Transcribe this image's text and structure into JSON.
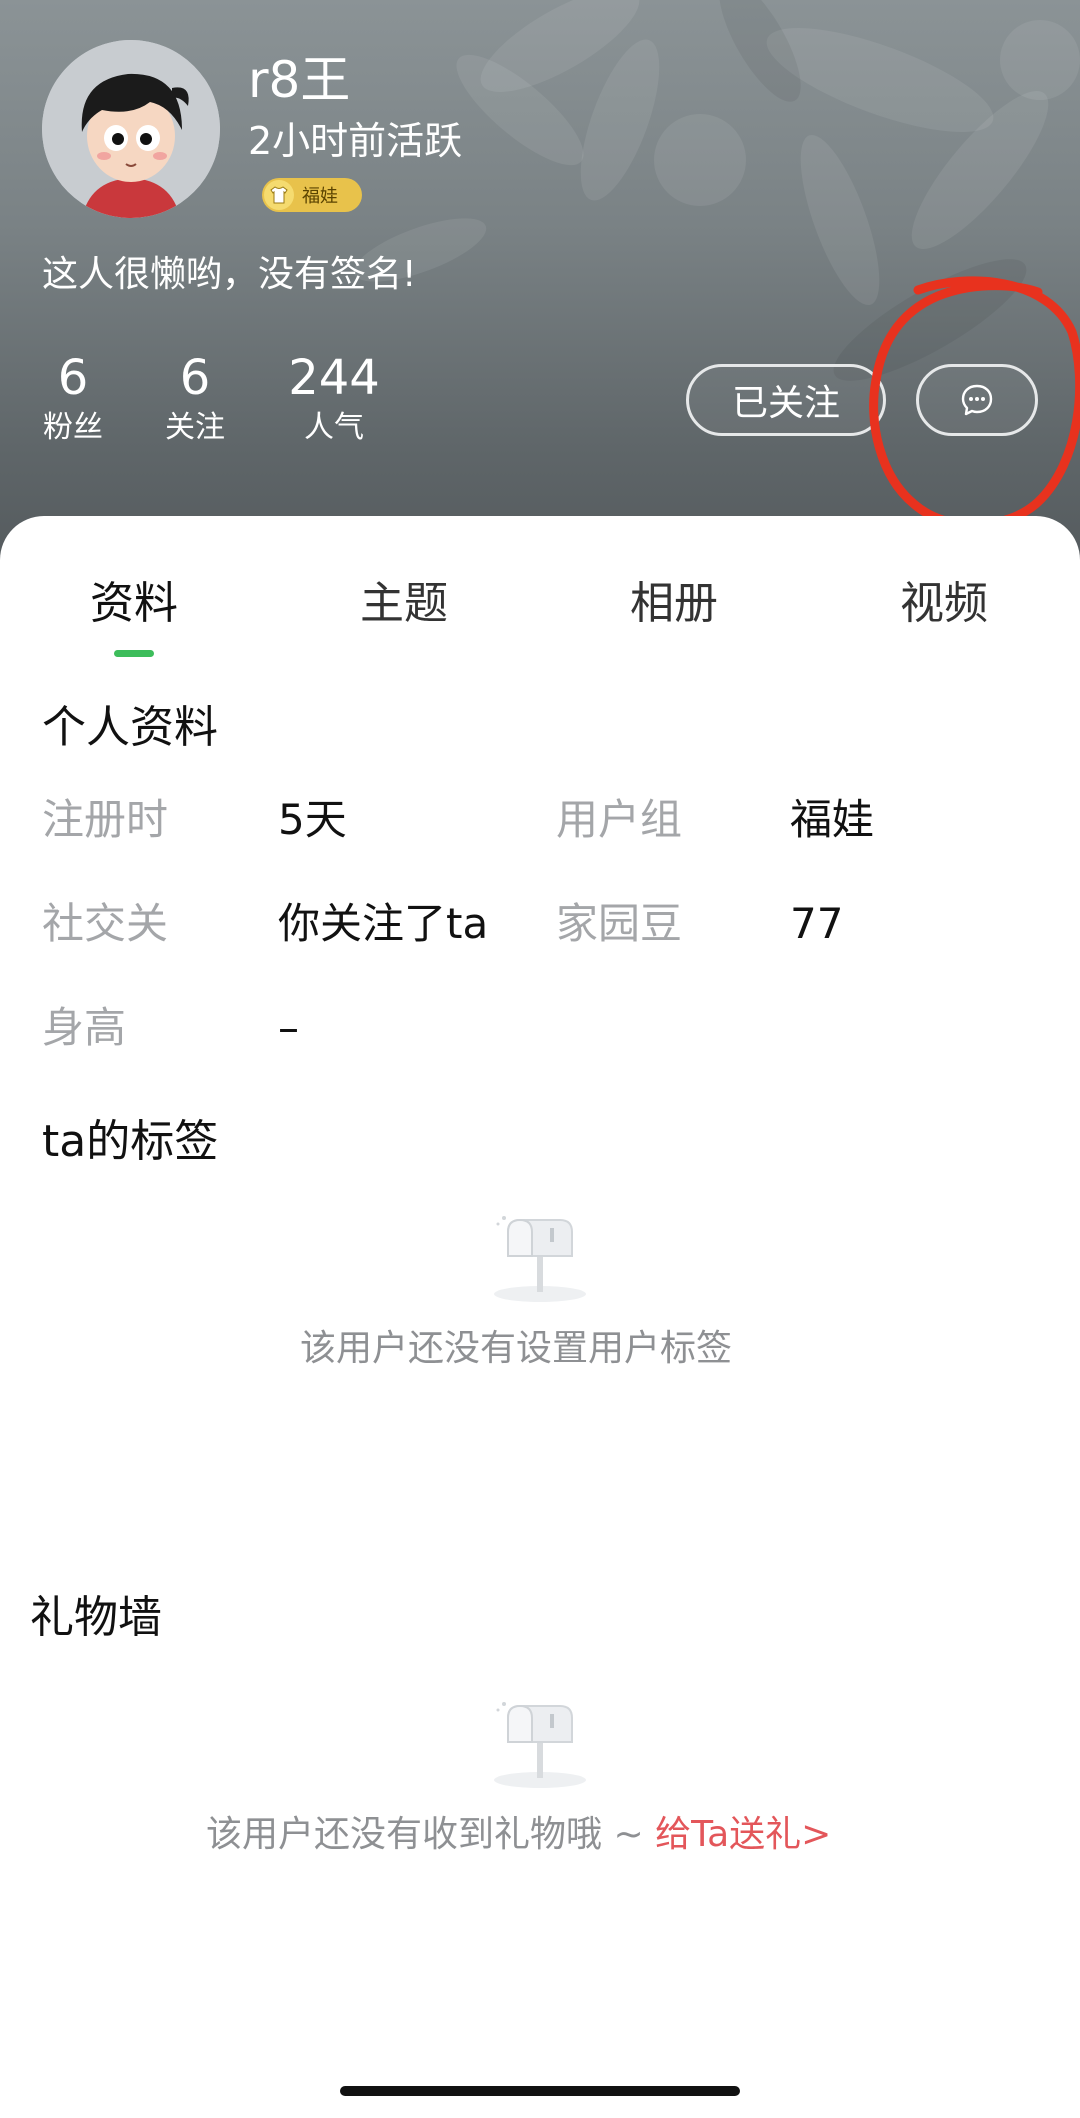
{
  "profile": {
    "username": "r8王",
    "active_status": "2小时前活跃",
    "badge_label": "福娃",
    "signature": "这人很懒哟，没有签名!"
  },
  "stats": [
    {
      "value": "6",
      "label": "粉丝"
    },
    {
      "value": "6",
      "label": "关注"
    },
    {
      "value": "244",
      "label": "人气"
    }
  ],
  "actions": {
    "follow_label": "已关注",
    "message_icon": "chat-bubble-icon"
  },
  "tabs": [
    {
      "label": "资料",
      "active": true
    },
    {
      "label": "主题",
      "active": false
    },
    {
      "label": "相册",
      "active": false
    },
    {
      "label": "视频",
      "active": false
    }
  ],
  "personal_info": {
    "title": "个人资料",
    "fields": [
      {
        "key": "注册时",
        "value": "5天"
      },
      {
        "key": "用户组",
        "value": "福娃"
      },
      {
        "key": "社交关",
        "value": "你关注了ta"
      },
      {
        "key": "家园豆",
        "value": "77"
      },
      {
        "key": "身高",
        "value": "–"
      }
    ]
  },
  "tags": {
    "title": "ta的标签",
    "empty_text": "该用户还没有设置用户标签"
  },
  "gifts": {
    "title": "礼物墙",
    "empty_text": "该用户还没有收到礼物哦 ~ ",
    "send_link": "给Ta送礼>"
  },
  "colors": {
    "accent_green": "#3dbd5b",
    "link_red": "#e3565a",
    "annotation_red": "#e8321e"
  }
}
